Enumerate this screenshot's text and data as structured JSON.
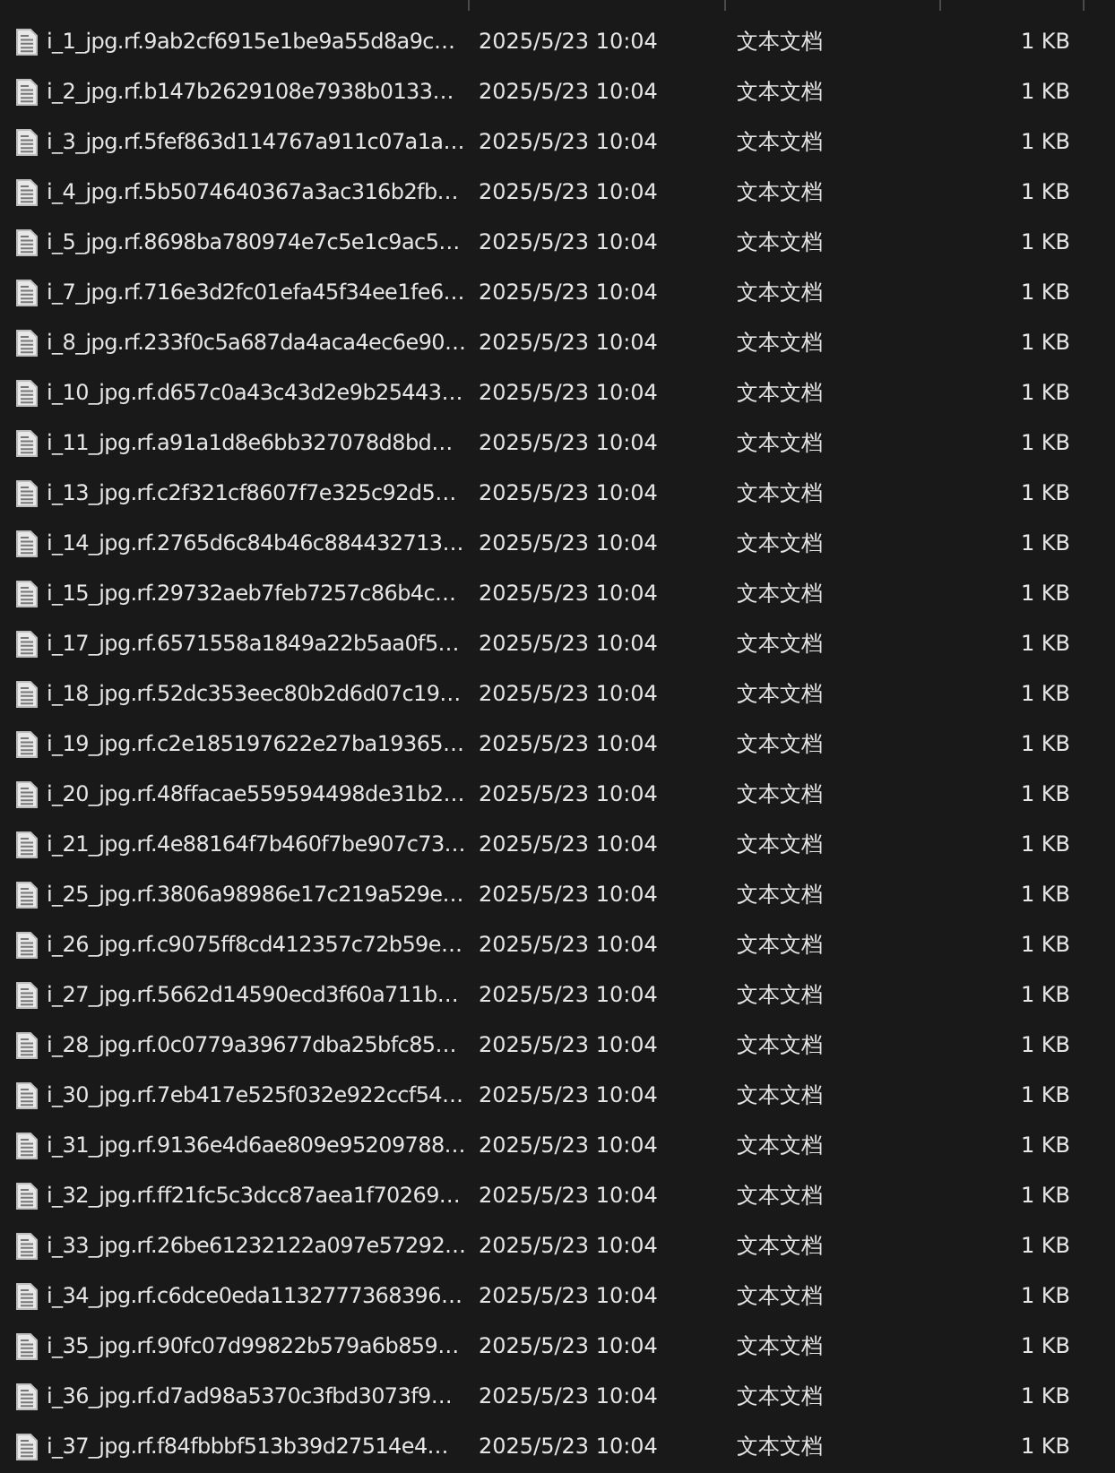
{
  "files": [
    {
      "name": "i_1_jpg.rf.9ab2cf6915e1be9a55d8a9c…",
      "modified": "2025/5/23 10:04",
      "type": "文本文档",
      "size": "1 KB"
    },
    {
      "name": "i_2_jpg.rf.b147b2629108e7938b0133…",
      "modified": "2025/5/23 10:04",
      "type": "文本文档",
      "size": "1 KB"
    },
    {
      "name": "i_3_jpg.rf.5fef863d114767a911c07a1a…",
      "modified": "2025/5/23 10:04",
      "type": "文本文档",
      "size": "1 KB"
    },
    {
      "name": "i_4_jpg.rf.5b5074640367a3ac316b2fb…",
      "modified": "2025/5/23 10:04",
      "type": "文本文档",
      "size": "1 KB"
    },
    {
      "name": "i_5_jpg.rf.8698ba780974e7c5e1c9ac5…",
      "modified": "2025/5/23 10:04",
      "type": "文本文档",
      "size": "1 KB"
    },
    {
      "name": "i_7_jpg.rf.716e3d2fc01efa45f34ee1fe6…",
      "modified": "2025/5/23 10:04",
      "type": "文本文档",
      "size": "1 KB"
    },
    {
      "name": "i_8_jpg.rf.233f0c5a687da4aca4ec6e90…",
      "modified": "2025/5/23 10:04",
      "type": "文本文档",
      "size": "1 KB"
    },
    {
      "name": "i_10_jpg.rf.d657c0a43c43d2e9b25443…",
      "modified": "2025/5/23 10:04",
      "type": "文本文档",
      "size": "1 KB"
    },
    {
      "name": "i_11_jpg.rf.a91a1d8e6bb327078d8bd…",
      "modified": "2025/5/23 10:04",
      "type": "文本文档",
      "size": "1 KB"
    },
    {
      "name": "i_13_jpg.rf.c2f321cf8607f7e325c92d5…",
      "modified": "2025/5/23 10:04",
      "type": "文本文档",
      "size": "1 KB"
    },
    {
      "name": "i_14_jpg.rf.2765d6c84b46c884432713…",
      "modified": "2025/5/23 10:04",
      "type": "文本文档",
      "size": "1 KB"
    },
    {
      "name": "i_15_jpg.rf.29732aeb7feb7257c86b4c…",
      "modified": "2025/5/23 10:04",
      "type": "文本文档",
      "size": "1 KB"
    },
    {
      "name": "i_17_jpg.rf.6571558a1849a22b5aa0f5…",
      "modified": "2025/5/23 10:04",
      "type": "文本文档",
      "size": "1 KB"
    },
    {
      "name": "i_18_jpg.rf.52dc353eec80b2d6d07c19…",
      "modified": "2025/5/23 10:04",
      "type": "文本文档",
      "size": "1 KB"
    },
    {
      "name": "i_19_jpg.rf.c2e185197622e27ba19365…",
      "modified": "2025/5/23 10:04",
      "type": "文本文档",
      "size": "1 KB"
    },
    {
      "name": "i_20_jpg.rf.48ffacae559594498de31b2…",
      "modified": "2025/5/23 10:04",
      "type": "文本文档",
      "size": "1 KB"
    },
    {
      "name": "i_21_jpg.rf.4e88164f7b460f7be907c73…",
      "modified": "2025/5/23 10:04",
      "type": "文本文档",
      "size": "1 KB"
    },
    {
      "name": "i_25_jpg.rf.3806a98986e17c219a529e…",
      "modified": "2025/5/23 10:04",
      "type": "文本文档",
      "size": "1 KB"
    },
    {
      "name": "i_26_jpg.rf.c9075ff8cd412357c72b59e…",
      "modified": "2025/5/23 10:04",
      "type": "文本文档",
      "size": "1 KB"
    },
    {
      "name": "i_27_jpg.rf.5662d14590ecd3f60a711b…",
      "modified": "2025/5/23 10:04",
      "type": "文本文档",
      "size": "1 KB"
    },
    {
      "name": "i_28_jpg.rf.0c0779a39677dba25bfc85…",
      "modified": "2025/5/23 10:04",
      "type": "文本文档",
      "size": "1 KB"
    },
    {
      "name": "i_30_jpg.rf.7eb417e525f032e922ccf54…",
      "modified": "2025/5/23 10:04",
      "type": "文本文档",
      "size": "1 KB"
    },
    {
      "name": "i_31_jpg.rf.9136e4d6ae809e95209788…",
      "modified": "2025/5/23 10:04",
      "type": "文本文档",
      "size": "1 KB"
    },
    {
      "name": "i_32_jpg.rf.ff21fc5c3dcc87aea1f70269…",
      "modified": "2025/5/23 10:04",
      "type": "文本文档",
      "size": "1 KB"
    },
    {
      "name": "i_33_jpg.rf.26be61232122a097e57292…",
      "modified": "2025/5/23 10:04",
      "type": "文本文档",
      "size": "1 KB"
    },
    {
      "name": "i_34_jpg.rf.c6dce0eda1132777368396…",
      "modified": "2025/5/23 10:04",
      "type": "文本文档",
      "size": "1 KB"
    },
    {
      "name": "i_35_jpg.rf.90fc07d99822b579a6b859…",
      "modified": "2025/5/23 10:04",
      "type": "文本文档",
      "size": "1 KB"
    },
    {
      "name": "i_36_jpg.rf.d7ad98a5370c3fbd3073f9…",
      "modified": "2025/5/23 10:04",
      "type": "文本文档",
      "size": "1 KB"
    },
    {
      "name": "i_37_jpg.rf.f84fbbbf513b39d27514e4…",
      "modified": "2025/5/23 10:04",
      "type": "文本文档",
      "size": "1 KB"
    }
  ]
}
